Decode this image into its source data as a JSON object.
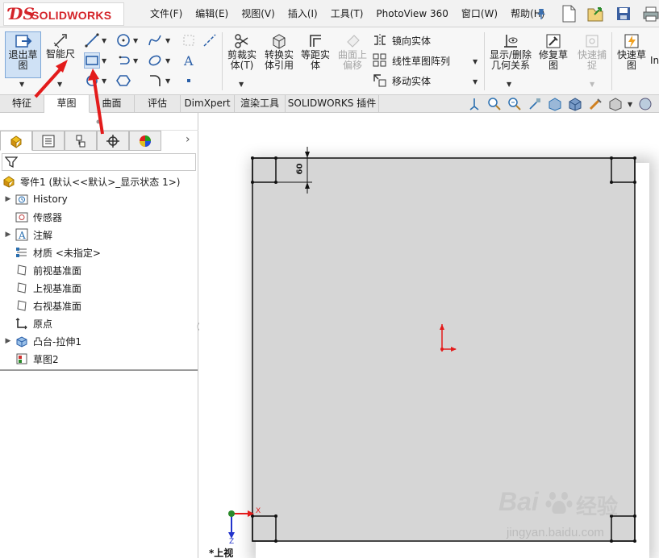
{
  "titlebar": {
    "logo_text": "SOLIDWORKS",
    "menus": [
      "文件(F)",
      "编辑(E)",
      "视图(V)",
      "插入(I)",
      "工具(T)",
      "PhotoView 360",
      "窗口(W)",
      "帮助(H)"
    ],
    "icons": [
      "pin-icon",
      "new-file-icon",
      "open-file-icon",
      "save-icon",
      "print-icon"
    ]
  },
  "ribbon": {
    "exit_sketch": "退出草\n图",
    "smart_dimension": "智能尺",
    "trim": "剪裁实\n体(T)",
    "convert": "转换实\n体引用",
    "offset": "等距实\n体",
    "surface_offset": "曲面上\n偏移",
    "mirror": "镜向实体",
    "linear_pattern": "线性草图阵列",
    "move": "移动实体",
    "display_relations": "显示/删除\n几何关系",
    "repair": "修复草\n图",
    "quick_snap": "快速捕\n捉",
    "rapid_sketch": "快速草\n图",
    "overflow": "In"
  },
  "tabs": [
    "特征",
    "草图",
    "曲面",
    "评估",
    "DimXpert",
    "渲染工具",
    "SOLIDWORKS 插件"
  ],
  "active_tab": "草图",
  "tree": {
    "root": "零件1 (默认<<默认>_显示状态 1>)",
    "items": [
      "History",
      "传感器",
      "注解",
      "材质 <未指定>",
      "前视基准面",
      "上视基准面",
      "右视基准面",
      "原点",
      "凸台-拉伸1",
      "草图2"
    ]
  },
  "viewport": {
    "dimension_value": "60",
    "view_label": "*上视",
    "axis_x": "X",
    "axis_z": "Z"
  },
  "watermark": {
    "brand": "Bai",
    "brand2": "经验",
    "url": "jingyan.baidu.com"
  },
  "colors": {
    "accent_red": "#e31b1b",
    "sheet": "#d6d6d6",
    "logo_red": "#d4242a"
  }
}
